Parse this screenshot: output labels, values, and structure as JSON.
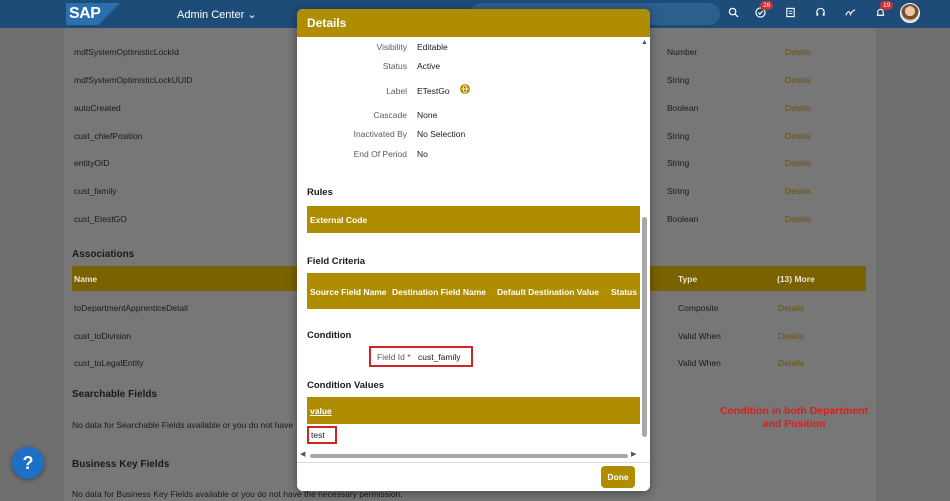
{
  "shell": {
    "logo_text": "SAP",
    "app_title": "Admin Center",
    "chevron": "⌄",
    "icons": [
      "search-icon",
      "approvals-icon",
      "reports-icon",
      "support-icon",
      "sign-icon",
      "notifications-icon"
    ],
    "approvals_count": "26",
    "notifications_count": "19"
  },
  "page": {
    "fields": [
      {
        "name": "mdfSystemOptimisticLockId",
        "type": "Number",
        "link": "Details"
      },
      {
        "name": "mdfSystemOptimisticLockUUID",
        "type": "String",
        "link": "Details"
      },
      {
        "name": "autoCreated",
        "type": "Boolean",
        "link": "Details"
      },
      {
        "name": "cust_chiefPosition",
        "type": "String",
        "link": "Details"
      },
      {
        "name": "entityOID",
        "type": "String",
        "link": "Details"
      },
      {
        "name": "cust_family",
        "type": "String",
        "link": "Details"
      },
      {
        "name": "cust_EtestGO",
        "type": "Boolean",
        "link": "Details"
      }
    ],
    "associations_title": "Associations",
    "assoc_headers": {
      "name": "Name",
      "type": "Type",
      "more": "(13) More"
    },
    "associations": [
      {
        "name": "toDepartmentApprenticeDetail",
        "type": "Composite",
        "link": "Details"
      },
      {
        "name": "cust_toDivision",
        "type": "Valid When",
        "link": "Details"
      },
      {
        "name": "cust_toLegalEntity",
        "type": "Valid When",
        "link": "Details"
      }
    ],
    "searchable_title": "Searchable Fields",
    "searchable_text": "No data for Searchable Fields available or you do not have",
    "business_key_title": "Business Key Fields",
    "business_key_text": "No data for Business Key Fields available or you do not have the necessary permission."
  },
  "dialog": {
    "title": "Details",
    "properties": [
      {
        "label": "Visibility",
        "value": "Editable"
      },
      {
        "label": "Status",
        "value": "Active"
      },
      {
        "label": "Label",
        "value": "ETestGo"
      },
      {
        "label": "Cascade",
        "value": "None"
      },
      {
        "label": "Inactivated By",
        "value": "No Selection"
      },
      {
        "label": "End Of Period",
        "value": "No"
      }
    ],
    "rules_title": "Rules",
    "rules_header": "External Code",
    "field_criteria_title": "Field Criteria",
    "criteria_headers": [
      "Source Field Name",
      "Destination Field Name",
      "Default Destination Value",
      "Status"
    ],
    "condition_title": "Condition",
    "field_id_label": "Field Id",
    "required_mark": "*",
    "field_id_value": "cust_family",
    "condition_values_title": "Condition Values",
    "value_header": "value",
    "value_row": "test",
    "done_label": "Done"
  },
  "help_label": "?",
  "annotation": "Condition in both Department and Position",
  "colors": {
    "shell": "#1d4c78",
    "accent": "#b08d00",
    "highlight": "#d32424"
  }
}
